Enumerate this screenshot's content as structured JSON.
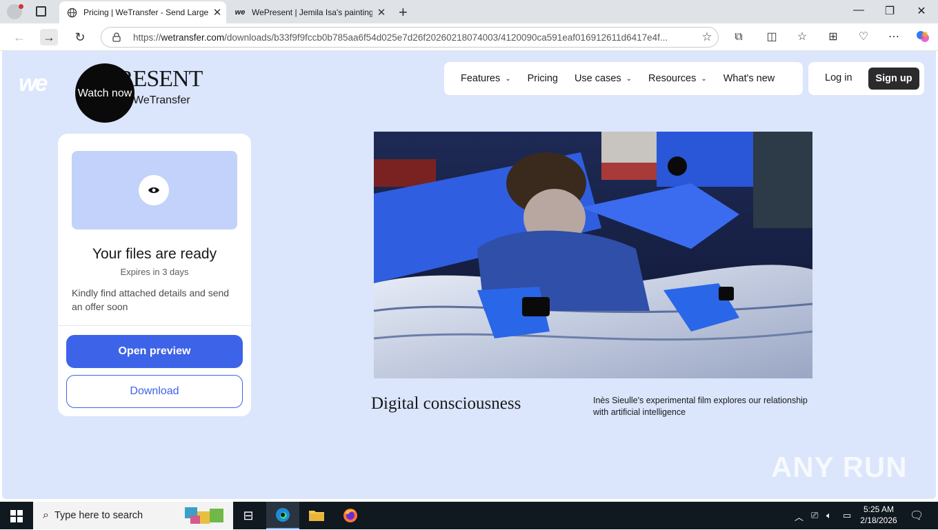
{
  "browser": {
    "tabs": [
      {
        "title": "Pricing | WeTransfer - Send Large",
        "active": true
      },
      {
        "title": "WePresent | Jemila Isa's paintings",
        "active": false
      }
    ],
    "url_prefix": "https://",
    "url_domain": "wetransfer.com",
    "url_rest": "/downloads/b33f9f9fccb0b785aa6f54d025e7d26f20260218074003/4120090ca591eaf016912611d6417e4f..."
  },
  "header": {
    "brand_wordmark": "PRESENT",
    "brand_by": "WeTransfer",
    "watch_now": "Watch now",
    "nav": [
      {
        "label": "Features",
        "dropdown": true
      },
      {
        "label": "Pricing",
        "dropdown": false
      },
      {
        "label": "Use cases",
        "dropdown": true
      },
      {
        "label": "Resources",
        "dropdown": true
      },
      {
        "label": "What's new",
        "dropdown": false
      }
    ],
    "login": "Log in",
    "signup": "Sign up"
  },
  "files_card": {
    "title": "Your files are ready",
    "expires": "Expires in 3 days",
    "message": "Kindly find attached details and send an offer soon",
    "open_preview": "Open preview",
    "download": "Download"
  },
  "feature": {
    "title": "Digital consciousness",
    "description": "Inès Sieulle's experimental film explores our relationship with artificial intelligence"
  },
  "watermark": "ANY RUN",
  "taskbar": {
    "search_placeholder": "Type here to search",
    "time": "5:25 AM",
    "date": "2/18/2026"
  }
}
